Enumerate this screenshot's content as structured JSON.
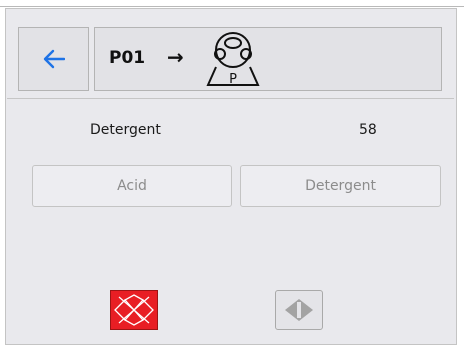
{
  "header": {
    "back_icon": "arrow-left-icon",
    "title": "P01",
    "arrow_icon": "arrow-right-icon",
    "pump_icon": "pump-icon",
    "pump_letter": "P"
  },
  "detail": {
    "label": "Detergent",
    "value": "58"
  },
  "choices": {
    "acid_label": "Acid",
    "detergent_label": "Detergent"
  },
  "controls": {
    "stop_icon": "stop-pattern-icon",
    "run_icon": "run-diamond-icon"
  },
  "colors": {
    "accent_blue": "#1e73e6",
    "stop_red": "#e81e24",
    "panel_bg": "#e9e9ed"
  }
}
